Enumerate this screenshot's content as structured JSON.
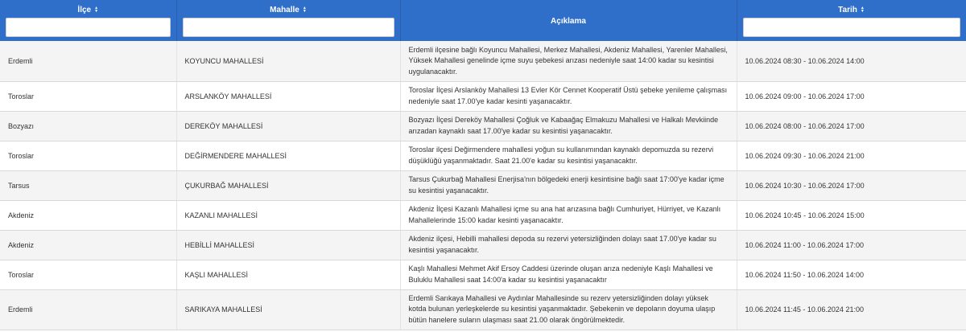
{
  "header": {
    "ilce": "İlçe",
    "mahalle": "Mahalle",
    "aciklama": "Açıklama",
    "tarih": "Tarih"
  },
  "filters": {
    "ilce": "",
    "mahalle": "",
    "tarih": ""
  },
  "rows": [
    {
      "ilce": "Erdemli",
      "mahalle": "KOYUNCU MAHALLESİ",
      "aciklama": "Erdemli ilçesine bağlı Koyuncu Mahallesi, Merkez Mahallesi, Akdeniz Mahallesi, Yarenler Mahallesi, Yüksek Mahallesi genelinde içme suyu şebekesi arızası nedeniyle saat 14:00 kadar su kesintisi uygulanacaktır.",
      "tarih": "10.06.2024 08:30 - 10.06.2024 14:00"
    },
    {
      "ilce": "Toroslar",
      "mahalle": "ARSLANKÖY MAHALLESİ",
      "aciklama": "Toroslar İlçesi Arslanköy Mahallesi 13 Evler Kör Cennet Kooperatif Üstü şebeke yenileme çalışması nedeniyle saat 17.00'ye kadar kesinti yaşanacaktır.",
      "tarih": "10.06.2024 09:00 - 10.06.2024 17:00"
    },
    {
      "ilce": "Bozyazı",
      "mahalle": "DEREKÖY MAHALLESİ",
      "aciklama": "Bozyazı İlçesi Dereköy Mahallesi Çoğluk ve Kabaağaç Elmakuzu Mahallesi ve Halkalı Mevkiinde arızadan kaynaklı saat 17.00'ye kadar su kesintisi yaşanacaktır.",
      "tarih": "10.06.2024 08:00 - 10.06.2024 17:00"
    },
    {
      "ilce": "Toroslar",
      "mahalle": "DEĞİRMENDERE MAHALLESİ",
      "aciklama": "Toroslar ilçesi Değirmendere mahallesi yoğun su kullanımından kaynaklı depomuzda su rezervi düşüklüğü yaşanmaktadır. Saat 21.00'e kadar su kesintisi yaşanacaktır.",
      "tarih": "10.06.2024 09:30 - 10.06.2024 21:00"
    },
    {
      "ilce": "Tarsus",
      "mahalle": "ÇUKURBAĞ MAHALLESİ",
      "aciklama": "Tarsus Çukurbağ Mahallesi Enerjisa'nın bölgedeki enerji kesintisine bağlı saat 17:00'ye kadar içme su kesintisi yaşanacaktır.",
      "tarih": "10.06.2024 10:30 - 10.06.2024 17:00"
    },
    {
      "ilce": "Akdeniz",
      "mahalle": "KAZANLI MAHALLESİ",
      "aciklama": "Akdeniz İlçesi Kazanlı Mahallesi içme su ana hat arızasına bağlı Cumhuriyet, Hürriyet, ve Kazanlı Mahallelerinde 15:00 kadar kesinti yaşanacaktır.",
      "tarih": "10.06.2024 10:45 - 10.06.2024 15:00"
    },
    {
      "ilce": "Akdeniz",
      "mahalle": "HEBİLLİ MAHALLESİ",
      "aciklama": "Akdeniz ilçesi, Hebilli mahallesi depoda su rezervi yetersizliğinden dolayı saat 17.00'ye kadar su kesintisi yaşanacaktır.",
      "tarih": "10.06.2024 11:00 - 10.06.2024 17:00"
    },
    {
      "ilce": "Toroslar",
      "mahalle": "KAŞLI MAHALLESİ",
      "aciklama": "Kaşlı Mahallesi Mehmet Akif Ersoy Caddesi üzerinde oluşan arıza nedeniyle Kaşlı Mahallesi ve Buluklu Mahallesi saat 14:00'a kadar su kesintisi yaşanacaktır",
      "tarih": "10.06.2024 11:50 - 10.06.2024 14:00"
    },
    {
      "ilce": "Erdemli",
      "mahalle": "SARIKAYA MAHALLESİ",
      "aciklama": "Erdemli Sarıkaya Mahallesi ve Aydınlar Mahallesinde su rezerv yetersizliğinden dolayı yüksek kotda bulunan yerleşkelerde su kesintisi yaşanmaktadır. Şebekenin ve depoların doyuma ulaşıp bütün hanelere suların ulaşması saat 21.00 olarak öngörülmektedir.",
      "tarih": "10.06.2024 11:45 - 10.06.2024 21:00"
    }
  ]
}
